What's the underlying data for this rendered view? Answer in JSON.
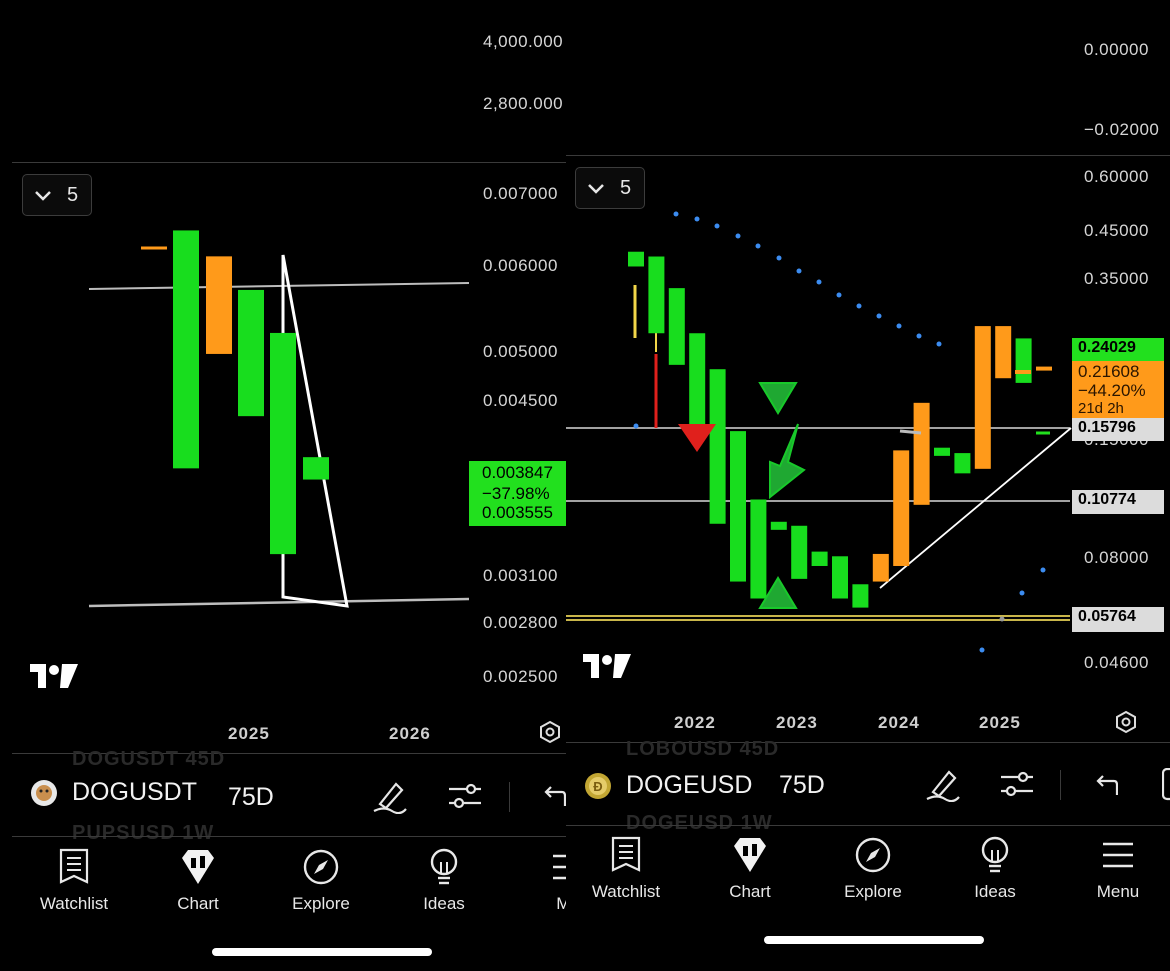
{
  "left_pane": {
    "top_axis_labels": [
      "4,000.000",
      "2,800.000"
    ],
    "range_button": {
      "value": "5"
    },
    "price_axis": [
      "0.007000",
      "0.006000",
      "0.005000",
      "0.004500",
      "0.003100",
      "0.002800",
      "0.002500"
    ],
    "price_tags": {
      "last": "0.003847",
      "change": "−37.98%",
      "low": "0.003555",
      "color": "#22e01e"
    },
    "time_axis": [
      "2025",
      "2026"
    ],
    "ghost_rows": [
      "DOGUSDT   45D",
      "PUPSUSD   1W"
    ],
    "symbol": "DOGUSDT",
    "interval": "75D",
    "nav": [
      {
        "label": "Watchlist",
        "icon": "watchlist-icon"
      },
      {
        "label": "Chart",
        "icon": "chart-icon"
      },
      {
        "label": "Explore",
        "icon": "compass-icon"
      },
      {
        "label": "Ideas",
        "icon": "lightbulb-icon"
      },
      {
        "label": "Me",
        "icon": "menu-icon"
      }
    ],
    "chart_data": {
      "type": "candlestick",
      "x_ticks": [
        "2025",
        "2026"
      ],
      "candles": [
        {
          "dir": "up",
          "open": 0.00395,
          "close": 0.00648
        },
        {
          "dir": "down",
          "open": 0.00612,
          "close": 0.00497
        },
        {
          "dir": "up",
          "open": 0.00437,
          "close": 0.00571
        },
        {
          "dir": "up",
          "open": 0.00326,
          "close": 0.00521
        },
        {
          "dir": "up",
          "open": 0.00386,
          "close": 0.00404
        }
      ]
    }
  },
  "right_pane": {
    "top_axis_labels": [
      "0.00000",
      "−0.02000"
    ],
    "range_button": {
      "value": "5"
    },
    "price_axis": [
      "0.60000",
      "0.45000",
      "0.35000",
      "0.15000",
      "0.08000",
      "0.04600"
    ],
    "price_tags": [
      {
        "text": "0.24029",
        "bg": "#22e01e",
        "fg": "#000000"
      },
      {
        "text": "0.21608",
        "bg": "#ff9a1a",
        "fg": "#2a1500"
      },
      {
        "text": "−44.20%",
        "bg": "#ff9a1a",
        "fg": "#2a1500"
      },
      {
        "text": "21d 2h",
        "bg": "#ff9a1a",
        "fg": "#2a1500"
      },
      {
        "text": "0.15796",
        "bg": "#dcdcdc",
        "fg": "#000000"
      },
      {
        "text": "0.10774",
        "bg": "#dcdcdc",
        "fg": "#000000"
      },
      {
        "text": "0.05764",
        "bg": "#dcdcdc",
        "fg": "#000000"
      }
    ],
    "time_axis": [
      "2022",
      "2023",
      "2024",
      "2025"
    ],
    "ghost_rows": [
      "LOBOUSD   45D",
      "DOGEUSD   1W"
    ],
    "symbol": "DOGEUSD",
    "interval": "75D",
    "nav": [
      {
        "label": "Watchlist",
        "icon": "watchlist-icon"
      },
      {
        "label": "Chart",
        "icon": "chart-icon"
      },
      {
        "label": "Explore",
        "icon": "compass-icon"
      },
      {
        "label": "Ideas",
        "icon": "lightbulb-icon"
      },
      {
        "label": "Menu",
        "icon": "menu-icon"
      }
    ],
    "chart_data": {
      "type": "candlestick",
      "x_ticks": [
        "2022",
        "2023",
        "2024",
        "2025"
      ],
      "horizontal_levels": [
        0.15796,
        0.10774,
        0.05764
      ],
      "candles": [
        {
          "dir": "up",
          "open": 0.37,
          "close": 0.4
        },
        {
          "dir": "up",
          "open": 0.26,
          "close": 0.39
        },
        {
          "dir": "up",
          "open": 0.22,
          "close": 0.33
        },
        {
          "dir": "up",
          "open": 0.16,
          "close": 0.26
        },
        {
          "dir": "up",
          "open": 0.095,
          "close": 0.215
        },
        {
          "dir": "up",
          "open": 0.07,
          "close": 0.155
        },
        {
          "dir": "up",
          "open": 0.064,
          "close": 0.108
        },
        {
          "dir": "up",
          "open": 0.092,
          "close": 0.096
        },
        {
          "dir": "up",
          "open": 0.071,
          "close": 0.094
        },
        {
          "dir": "up",
          "open": 0.076,
          "close": 0.082
        },
        {
          "dir": "up",
          "open": 0.064,
          "close": 0.08
        },
        {
          "dir": "up",
          "open": 0.061,
          "close": 0.069
        },
        {
          "dir": "down",
          "open": 0.081,
          "close": 0.07
        },
        {
          "dir": "down",
          "open": 0.14,
          "close": 0.076
        },
        {
          "dir": "down",
          "open": 0.18,
          "close": 0.105
        },
        {
          "dir": "up",
          "open": 0.136,
          "close": 0.142
        },
        {
          "dir": "up",
          "open": 0.124,
          "close": 0.138
        },
        {
          "dir": "down",
          "open": 0.27,
          "close": 0.127
        },
        {
          "dir": "down",
          "open": 0.27,
          "close": 0.205
        },
        {
          "dir": "up",
          "open": 0.2,
          "close": 0.253
        },
        {
          "dir": "down",
          "open": 0.218,
          "close": 0.214
        }
      ]
    }
  }
}
